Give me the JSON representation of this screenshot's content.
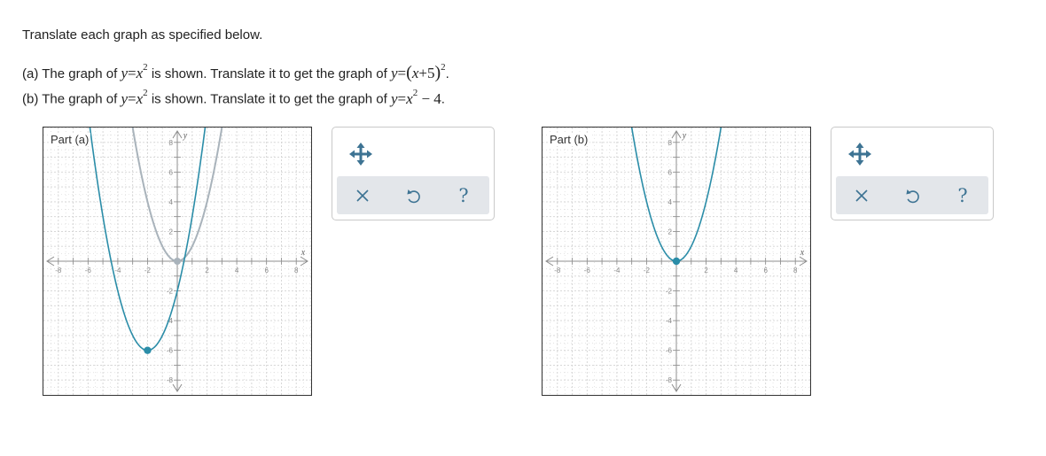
{
  "instructions": "Translate each graph as specified below.",
  "questions": [
    {
      "prefix": "(a) The graph of",
      "given_eq": "y=x²",
      "middle": "is shown. Translate it to get the graph of",
      "target_eq": "y=(x+5)²",
      "end": "."
    },
    {
      "prefix": "(b) The graph of",
      "given_eq": "y=x²",
      "middle": "is shown. Translate it to get the graph of",
      "target_eq": "y=x²−4",
      "end": "."
    }
  ],
  "graphs": [
    {
      "label": "Part (a)",
      "x_axis_label": "x",
      "y_axis_label": "y",
      "x_range": [
        -9,
        9
      ],
      "y_range": [
        -9,
        9
      ],
      "x_ticks": [
        "-8",
        "-6",
        "-4",
        "-2",
        "2",
        "4",
        "6",
        "8"
      ],
      "y_ticks": [
        "8",
        "6",
        "4",
        "2",
        "-2",
        "-4",
        "-6",
        "-8"
      ],
      "original_parabola": {
        "vertex": [
          0,
          0
        ],
        "color": "#a9b3bb"
      },
      "student_parabola": {
        "vertex": [
          -2,
          -6
        ],
        "color": "#2b8da8"
      }
    },
    {
      "label": "Part (b)",
      "x_axis_label": "x",
      "y_axis_label": "y",
      "x_range": [
        -9,
        9
      ],
      "y_range": [
        -9,
        9
      ],
      "x_ticks": [
        "-8",
        "-6",
        "-4",
        "-2",
        "2",
        "4",
        "6",
        "8"
      ],
      "y_ticks": [
        "8",
        "6",
        "4",
        "2",
        "-2",
        "-4",
        "-6",
        "-8"
      ],
      "student_parabola": {
        "vertex": [
          0,
          0
        ],
        "color": "#2b8da8"
      }
    }
  ],
  "toolbox": {
    "move_icon": "move-arrows-icon",
    "clear_icon": "close-icon",
    "undo_icon": "undo-icon",
    "help_label": "?"
  },
  "colors": {
    "grid": "#d3d3d3",
    "axis": "#8c8c8c",
    "tool_icon": "#3d7393",
    "parabola": "#2b8da8",
    "original": "#a9b3bb"
  }
}
